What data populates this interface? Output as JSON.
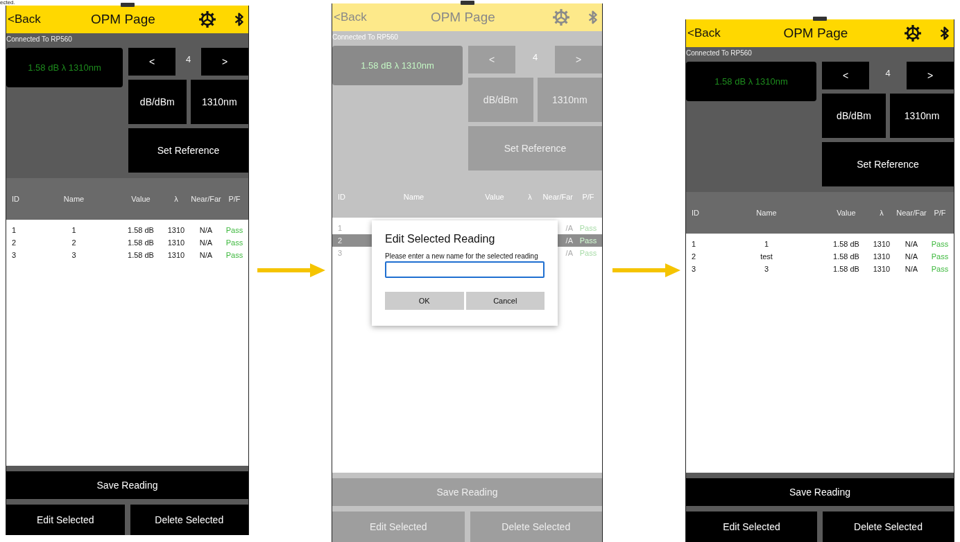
{
  "caption": "ected.",
  "screens": [
    {
      "dimmed": false,
      "header": {
        "back": "<Back",
        "title": "OPM Page"
      },
      "connection": "Connected To RP560",
      "reading": "1.58 dB λ 1310nm",
      "prev": "<",
      "index": "4",
      "next": ">",
      "unit_button": "dB/dBm",
      "wavelength_button": "1310nm",
      "set_reference": "Set Reference",
      "columns": [
        "ID",
        "Name",
        "Value",
        "λ",
        "Near/Far",
        "P/F"
      ],
      "rows": [
        {
          "id": "1",
          "name": "1",
          "value": "1.58 dB",
          "wavelength": "1310",
          "near_far": "N/A",
          "pf": "Pass",
          "selected": false
        },
        {
          "id": "2",
          "name": "2",
          "value": "1.58 dB",
          "wavelength": "1310",
          "near_far": "N/A",
          "pf": "Pass",
          "selected": false
        },
        {
          "id": "3",
          "name": "3",
          "value": "1.58 dB",
          "wavelength": "1310",
          "near_far": "N/A",
          "pf": "Pass",
          "selected": false
        }
      ],
      "save_button": "Save Reading",
      "edit_button": "Edit Selected",
      "delete_button": "Delete Selected"
    },
    {
      "dimmed": true,
      "header": {
        "back": "<Back",
        "title": "OPM Page"
      },
      "connection": "Connected To RP560",
      "reading": "1.58 dB λ 1310nm",
      "prev": "<",
      "index": "4",
      "next": ">",
      "unit_button": "dB/dBm",
      "wavelength_button": "1310nm",
      "set_reference": "Set Reference",
      "columns": [
        "ID",
        "Name",
        "Value",
        "λ",
        "Near/Far",
        "P/F"
      ],
      "rows": [
        {
          "id": "1",
          "near_far": "/A",
          "pf": "Pass",
          "selected": false
        },
        {
          "id": "2",
          "near_far": "/A",
          "pf": "Pass",
          "selected": true
        },
        {
          "id": "3",
          "near_far": "/A",
          "pf": "Pass",
          "selected": false
        }
      ],
      "save_button": "Save Reading",
      "edit_button": "Edit Selected",
      "delete_button": "Delete Selected",
      "dialog": {
        "title": "Edit Selected Reading",
        "label": "Please enter a new name for the selected reading",
        "ok": "OK",
        "cancel": "Cancel"
      }
    },
    {
      "dimmed": false,
      "header": {
        "back": "<Back",
        "title": "OPM Page"
      },
      "connection": "Connected To RP560",
      "reading": "1.58 dB λ 1310nm",
      "prev": "<",
      "index": "4",
      "next": ">",
      "unit_button": "dB/dBm",
      "wavelength_button": "1310nm",
      "set_reference": "Set Reference",
      "columns": [
        "ID",
        "Name",
        "Value",
        "λ",
        "Near/Far",
        "P/F"
      ],
      "rows": [
        {
          "id": "1",
          "name": "1",
          "value": "1.58 dB",
          "wavelength": "1310",
          "near_far": "N/A",
          "pf": "Pass",
          "selected": false
        },
        {
          "id": "2",
          "name": "test",
          "value": "1.58 dB",
          "wavelength": "1310",
          "near_far": "N/A",
          "pf": "Pass",
          "selected": false
        },
        {
          "id": "3",
          "name": "3",
          "value": "1.58 dB",
          "wavelength": "1310",
          "near_far": "N/A",
          "pf": "Pass",
          "selected": false
        }
      ],
      "save_button": "Save Reading",
      "edit_button": "Edit Selected",
      "delete_button": "Delete Selected"
    }
  ]
}
